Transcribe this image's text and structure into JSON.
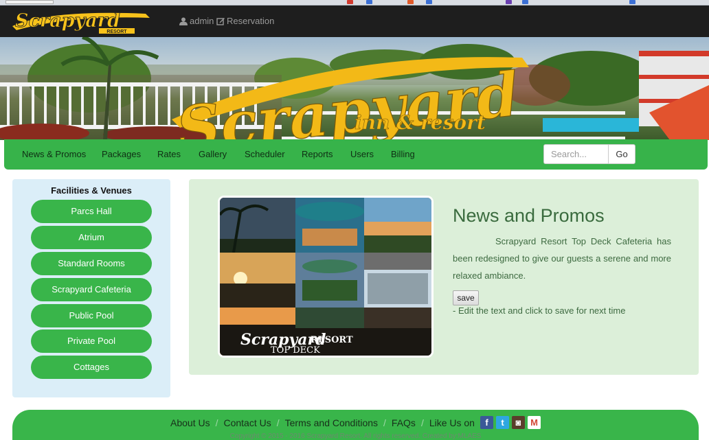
{
  "topbar": {
    "logo_text": "Scrapyard",
    "logo_sub": "RESORT",
    "admin_label": "admin",
    "reservation_label": "Reservation"
  },
  "banner": {
    "title": "Scrapyard",
    "subtitle": "inn & resort"
  },
  "menu": {
    "items": [
      "News & Promos",
      "Packages",
      "Rates",
      "Gallery",
      "Scheduler",
      "Reports",
      "Users",
      "Billing"
    ],
    "search_placeholder": "Search...",
    "go_label": "Go"
  },
  "sidebar": {
    "title": "Facilities & Venues",
    "items": [
      "Parcs Hall",
      "Atrium",
      "Standard Rooms",
      "Scrapyard Cafeteria",
      "Public Pool",
      "Private Pool",
      "Cottages"
    ]
  },
  "main": {
    "title": "News and Promos",
    "body": "Scrapyard Resort Top Deck Cafeteria has been redesigned to give our guests a serene and more relaxed ambiance.",
    "save_label": "save",
    "save_hint": "- Edit the text and click to save for next time",
    "collage_caption": "Scrapyard",
    "collage_caption_2": "RESORT",
    "collage_caption_3": "TOP DECK"
  },
  "footer": {
    "links": [
      "About Us",
      "Contact Us",
      "Terms and Conditions",
      "FAQs"
    ],
    "like_label": "Like Us on",
    "social": [
      "facebook-icon",
      "twitter-icon",
      "instagram-icon",
      "gmail-icon"
    ],
    "copyright": "Copyright © 2015 - 2016 Scrapyard Resort. All rights reserved. Created by:MLAES"
  },
  "colors": {
    "brand_green": "#39b54a",
    "logo_yellow": "#f7c21b",
    "panel_green": "#dcefd9",
    "sidebar_blue": "#dbeef8"
  }
}
